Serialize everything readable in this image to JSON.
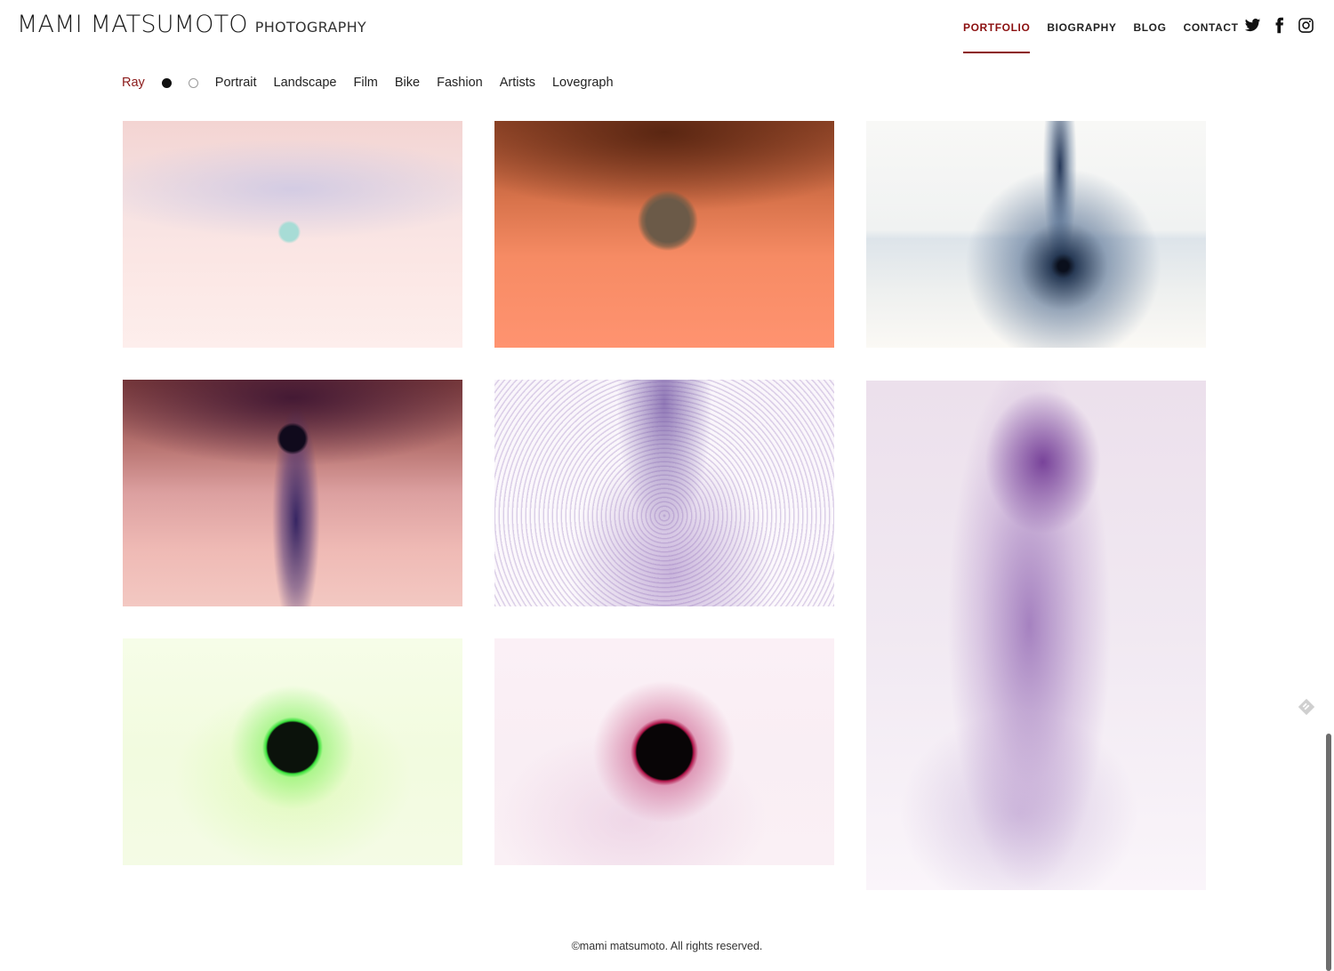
{
  "header": {
    "logo_main": "MAMI MATSUMOTO",
    "logo_sub": "PHOTOGRAPHY",
    "nav": [
      {
        "label": "PORTFOLIO",
        "active": true
      },
      {
        "label": "BIOGRAPHY",
        "active": false
      },
      {
        "label": "BLOG",
        "active": false
      },
      {
        "label": "CONTACT",
        "active": false
      }
    ],
    "social_icons": [
      "twitter-icon",
      "facebook-icon",
      "instagram-icon"
    ]
  },
  "filters": {
    "items": [
      "Ray",
      "Portrait",
      "Landscape",
      "Film",
      "Bike",
      "Fashion",
      "Artists",
      "Lovegraph"
    ],
    "active": "Ray",
    "dot_toggles": [
      "filled-dot",
      "hollow-dot"
    ]
  },
  "gallery": {
    "photos": [
      {
        "name": "photo-pink-cyan-sun"
      },
      {
        "name": "photo-orange-sun"
      },
      {
        "name": "photo-blue-spray"
      },
      {
        "name": "photo-pink-black-orbs"
      },
      {
        "name": "photo-purple-particles"
      },
      {
        "name": "photo-purple-vertical-smoke"
      },
      {
        "name": "photo-green-eclipse"
      },
      {
        "name": "photo-pink-eclipse"
      }
    ]
  },
  "footer": {
    "copyright": "©mami matsumoto. All rights reserved."
  },
  "colors": {
    "accent": "#8b0f0f",
    "text": "#222222",
    "background": "#ffffff"
  }
}
